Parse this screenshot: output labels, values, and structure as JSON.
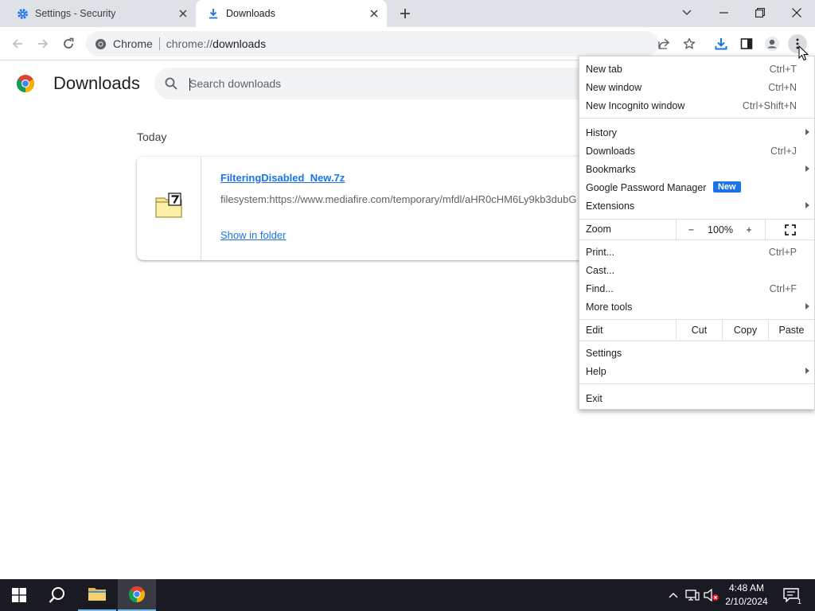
{
  "browser": {
    "tabs": [
      {
        "title": "Settings - Security",
        "icon": "gear-icon",
        "active": false
      },
      {
        "title": "Downloads",
        "icon": "download-icon",
        "active": true
      }
    ],
    "omnibox": {
      "chip": "Chrome",
      "url_prefix": "chrome://",
      "url_path": "downloads"
    }
  },
  "page": {
    "title": "Downloads",
    "search_placeholder": "Search downloads",
    "section_date": "Today",
    "download": {
      "file_name": "FilteringDisabled_New.7z",
      "source_url": "filesystem:https://www.mediafire.com/temporary/mfdl/aHR0cHM6Ly9kb3dubG",
      "action": "Show in folder",
      "file_icon": "7z-archive-icon"
    }
  },
  "menu": {
    "items_group1": [
      {
        "label": "New tab",
        "shortcut": "Ctrl+T"
      },
      {
        "label": "New window",
        "shortcut": "Ctrl+N"
      },
      {
        "label": "New Incognito window",
        "shortcut": "Ctrl+Shift+N"
      }
    ],
    "items_group2": [
      {
        "label": "History",
        "shortcut": "",
        "submenu": true
      },
      {
        "label": "Downloads",
        "shortcut": "Ctrl+J",
        "submenu": false
      },
      {
        "label": "Bookmarks",
        "shortcut": "",
        "submenu": true
      },
      {
        "label": "Google Password Manager",
        "shortcut": "",
        "submenu": false,
        "badge": "New"
      },
      {
        "label": "Extensions",
        "shortcut": "",
        "submenu": true
      }
    ],
    "zoom": {
      "label": "Zoom",
      "minus": "−",
      "value": "100%",
      "plus": "+"
    },
    "items_group3": [
      {
        "label": "Print...",
        "shortcut": "Ctrl+P",
        "submenu": false
      },
      {
        "label": "Cast...",
        "shortcut": "",
        "submenu": false
      },
      {
        "label": "Find...",
        "shortcut": "Ctrl+F",
        "submenu": false
      },
      {
        "label": "More tools",
        "shortcut": "",
        "submenu": true
      }
    ],
    "edit": {
      "label": "Edit",
      "cut": "Cut",
      "copy": "Copy",
      "paste": "Paste"
    },
    "items_group4": [
      {
        "label": "Settings",
        "submenu": false
      },
      {
        "label": "Help",
        "submenu": true
      }
    ],
    "exit": "Exit"
  },
  "taskbar": {
    "time": "4:48 AM",
    "date": "2/10/2024",
    "notification_count": "1"
  },
  "colors": {
    "accent": "#1a73e8",
    "tabstrip": "#dee1e6",
    "omnibox": "#f1f3f4",
    "taskbar": "#1a1b22"
  }
}
